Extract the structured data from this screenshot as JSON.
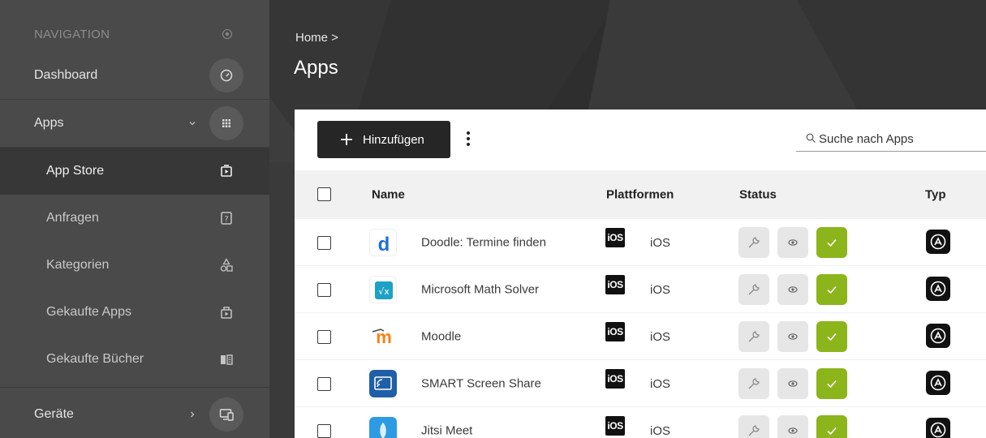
{
  "sidebar": {
    "heading": "NAVIGATION",
    "items": [
      {
        "label": "Dashboard",
        "icon": "dashboard-gauge-icon"
      },
      {
        "label": "Apps",
        "icon": "grid-icon"
      },
      {
        "label": "App Store",
        "icon": "app-store-icon"
      },
      {
        "label": "Anfragen",
        "icon": "request-icon"
      },
      {
        "label": "Kategorien",
        "icon": "categories-icon"
      },
      {
        "label": "Gekaufte Apps",
        "icon": "purchased-apps-icon"
      },
      {
        "label": "Gekaufte Bücher",
        "icon": "book-icon"
      },
      {
        "label": "Geräte",
        "icon": "devices-icon"
      }
    ]
  },
  "header": {
    "breadcrumb": "Home >",
    "title": "Apps"
  },
  "toolbar": {
    "add_label": "Hinzufügen",
    "search_placeholder": "Suche nach Apps"
  },
  "table": {
    "columns": {
      "name": "Name",
      "platforms": "Plattformen",
      "status": "Status",
      "type": "Typ"
    },
    "rows": [
      {
        "name": "Doodle: Termine finden",
        "badge": "iOS",
        "platform": "iOS",
        "icon": "doodle-icon"
      },
      {
        "name": "Microsoft Math Solver",
        "badge": "iOS",
        "platform": "iOS",
        "icon": "math-solver-icon"
      },
      {
        "name": "Moodle",
        "badge": "iOS",
        "platform": "iOS",
        "icon": "moodle-icon"
      },
      {
        "name": "SMART Screen Share",
        "badge": "iOS",
        "platform": "iOS",
        "icon": "screen-share-icon"
      },
      {
        "name": "Jitsi Meet",
        "badge": "iOS",
        "platform": "iOS",
        "icon": "jitsi-icon"
      }
    ]
  },
  "colors": {
    "sidebar_bg": "#4a4a4a",
    "active_bg": "#373737",
    "accent_green": "#8cb51c",
    "button_dark": "#262626"
  }
}
